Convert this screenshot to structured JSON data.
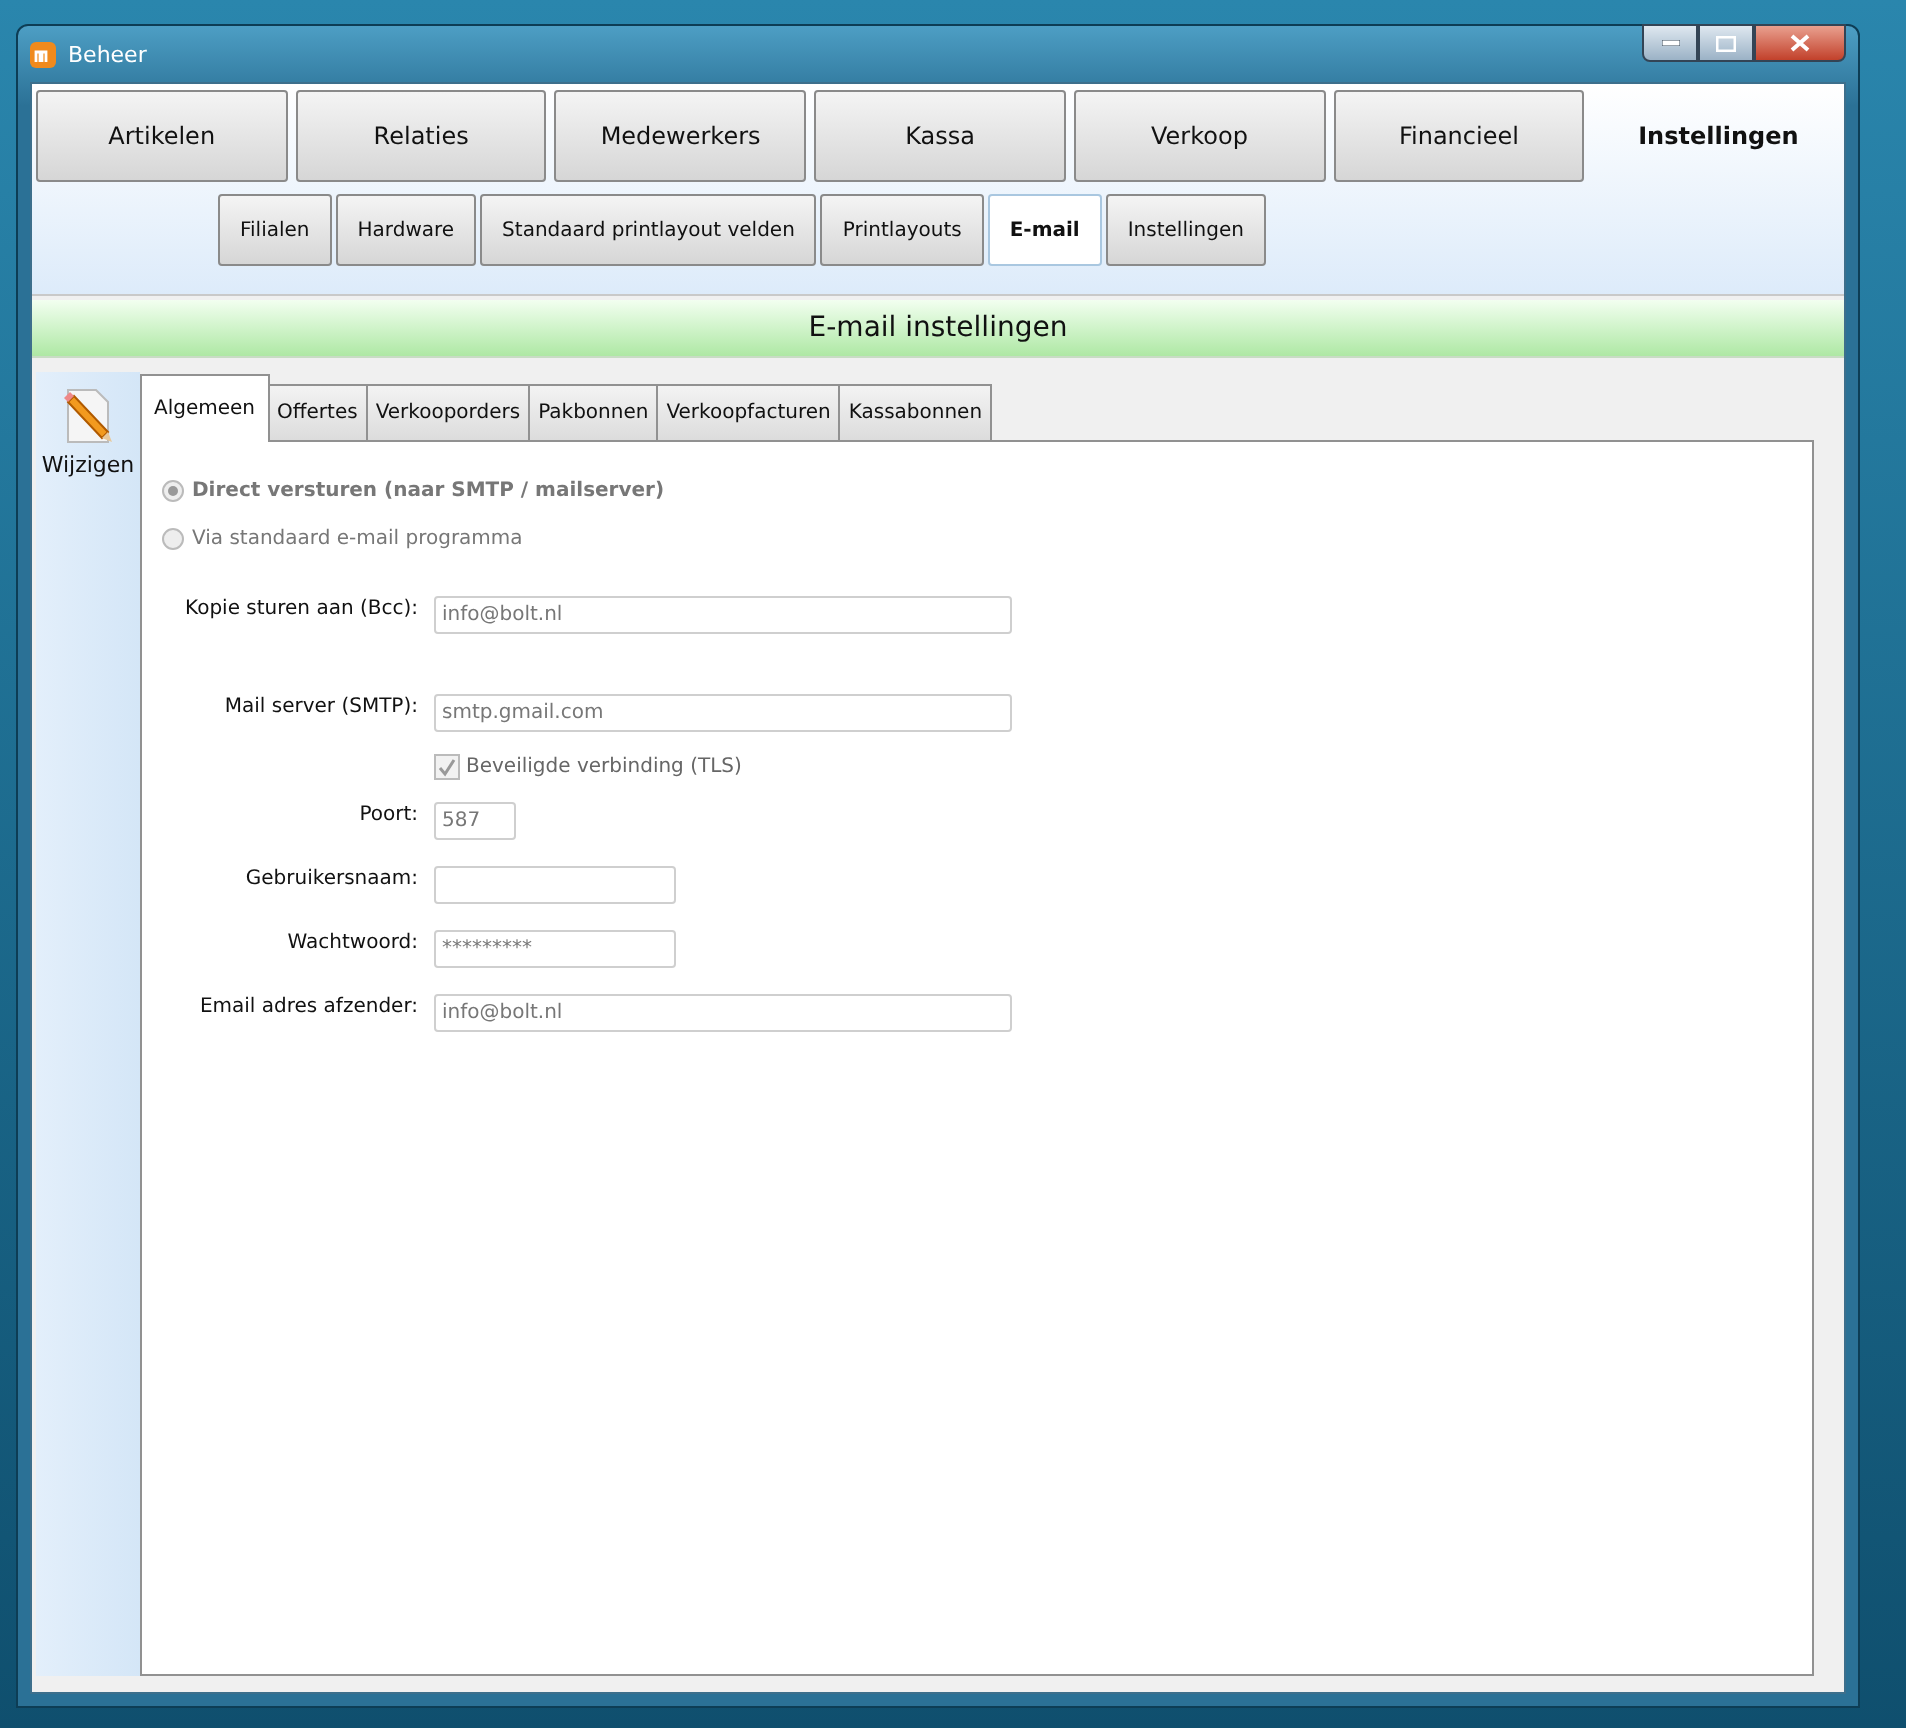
{
  "window": {
    "title": "Beheer"
  },
  "main_tabs": [
    {
      "label": "Artikelen",
      "selected": false
    },
    {
      "label": "Relaties",
      "selected": false
    },
    {
      "label": "Medewerkers",
      "selected": false
    },
    {
      "label": "Kassa",
      "selected": false
    },
    {
      "label": "Verkoop",
      "selected": false
    },
    {
      "label": "Financieel",
      "selected": false
    },
    {
      "label": "Instellingen",
      "selected": true
    }
  ],
  "sub_tabs": [
    {
      "label": "Filialen",
      "selected": false
    },
    {
      "label": "Hardware",
      "selected": false
    },
    {
      "label": "Standaard printlayout velden",
      "selected": false
    },
    {
      "label": "Printlayouts",
      "selected": false
    },
    {
      "label": "E-mail",
      "selected": true
    },
    {
      "label": "Instellingen",
      "selected": false
    }
  ],
  "header": {
    "title": "E-mail instellingen"
  },
  "sidebar": {
    "edit_button": "Wijzigen"
  },
  "content_tabs": [
    {
      "label": "Algemeen",
      "selected": true
    },
    {
      "label": "Offertes",
      "selected": false
    },
    {
      "label": "Verkooporders",
      "selected": false
    },
    {
      "label": "Pakbonnen",
      "selected": false
    },
    {
      "label": "Verkoopfacturen",
      "selected": false
    },
    {
      "label": "Kassabonnen",
      "selected": false
    }
  ],
  "delivery_options": [
    {
      "label": "Direct versturen (naar SMTP / mailserver)",
      "selected": true,
      "disabled": true
    },
    {
      "label": "Via standaard e-mail programma",
      "selected": false,
      "disabled": true
    }
  ],
  "bcc_field": {
    "label": "Kopie sturen aan (Bcc):",
    "value": "info@bolt.nl",
    "disabled": true
  },
  "smtp_rows": [
    {
      "kind": "wide",
      "label": "Mail server (SMTP):",
      "value": "smtp.gmail.com",
      "disabled": true
    },
    {
      "kind": "checkbox",
      "label": "Beveiligde verbinding (TLS)",
      "checked": true,
      "disabled": true
    },
    {
      "kind": "narrow",
      "label": "Poort:",
      "value": "587",
      "disabled": true
    },
    {
      "kind": "medium",
      "label": "Gebruikersnaam:",
      "disabled": true
    },
    {
      "kind": "medium",
      "label": "Wachtwoord:",
      "value": "*********",
      "disabled": true
    },
    {
      "kind": "wide",
      "label": "Email adres afzender:",
      "value": "info@bolt.nl",
      "disabled": true
    }
  ]
}
